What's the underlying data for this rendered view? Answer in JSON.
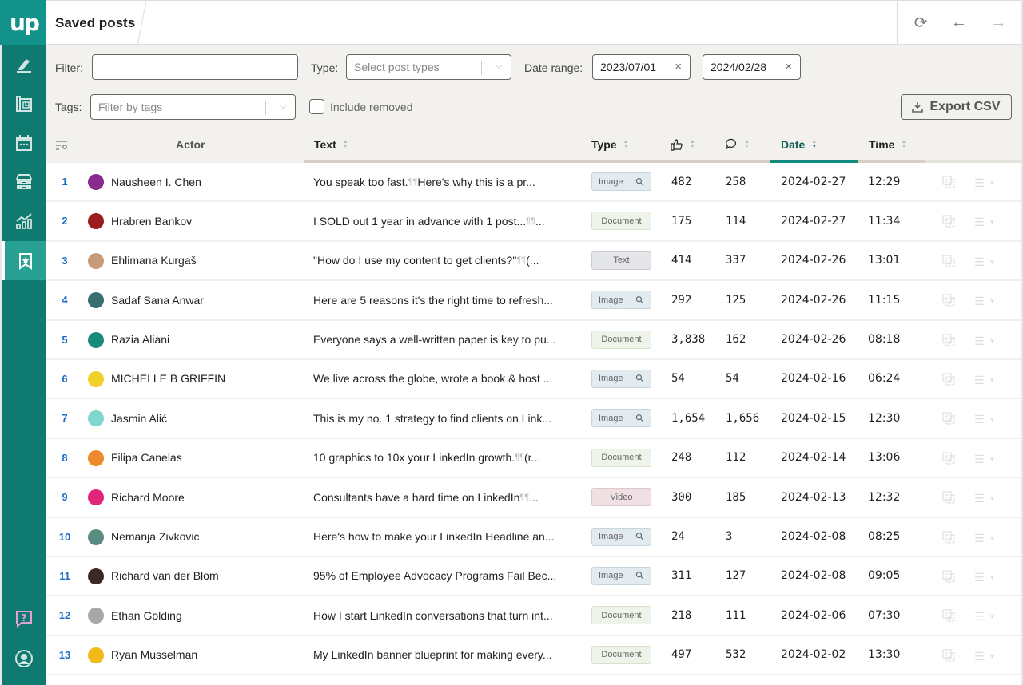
{
  "app": {
    "logo": "up",
    "title": "Saved posts"
  },
  "sidebar": {
    "items": [
      {
        "name": "compose",
        "icon": "pencil-icon"
      },
      {
        "name": "blueprint",
        "icon": "blueprint-icon"
      },
      {
        "name": "calendar",
        "icon": "calendar-icon"
      },
      {
        "name": "archive",
        "icon": "drawer-icon"
      },
      {
        "name": "analytics",
        "icon": "chart-icon"
      },
      {
        "name": "saved-posts",
        "icon": "bookmark-star-icon",
        "active": true
      }
    ],
    "bottom": [
      {
        "name": "help",
        "icon": "help-icon"
      },
      {
        "name": "profile",
        "icon": "user-icon"
      }
    ]
  },
  "topbar": {
    "refresh": "⟳",
    "back": "←",
    "forward": "→"
  },
  "filters": {
    "filter_label": "Filter:",
    "filter_value": "",
    "type_label": "Type:",
    "type_placeholder": "Select post types",
    "date_label": "Date range:",
    "date_from": "2023/07/01",
    "date_to": "2024/02/28",
    "date_sep": "–",
    "tags_label": "Tags:",
    "tags_placeholder": "Filter by tags",
    "include_removed_label": "Include removed",
    "include_removed": false,
    "export_label": "Export CSV"
  },
  "table": {
    "columns": {
      "actor": "Actor",
      "text": "Text",
      "type": "Type",
      "date": "Date",
      "time": "Time"
    },
    "sorted_by": "Date",
    "sort_dir": "desc",
    "rows": [
      {
        "n": "1",
        "actor": "Nausheen I. Chen",
        "text": "You speak too fast. ¶ ¶ Here's why this is a pr...",
        "type": "Image",
        "likes": "482",
        "comments": "258",
        "date": "2024-02-27",
        "time": "12:29",
        "avatar": "#8a2a8f"
      },
      {
        "n": "2",
        "actor": "Hrabren Bankov",
        "text": "I SOLD out 1 year in advance with 1 post... ¶ ¶ ...",
        "type": "Document",
        "likes": "175",
        "comments": "114",
        "date": "2024-02-27",
        "time": "11:34",
        "avatar": "#9a1c1c"
      },
      {
        "n": "3",
        "actor": "Ehlimana Kurgaš",
        "text": "\"How do I use my content to get clients?\" ¶ ¶ (...",
        "type": "Text",
        "likes": "414",
        "comments": "337",
        "date": "2024-02-26",
        "time": "13:01",
        "avatar": "#c79a7a"
      },
      {
        "n": "4",
        "actor": "Sadaf Sana Anwar",
        "text": "Here are 5 reasons it's the right time to refresh...",
        "type": "Image",
        "likes": "292",
        "comments": "125",
        "date": "2024-02-26",
        "time": "11:15",
        "avatar": "#3a6f70"
      },
      {
        "n": "5",
        "actor": "Razia Aliani",
        "text": "Everyone says a well-written paper is key to pu...",
        "type": "Document",
        "likes": "3,838",
        "comments": "162",
        "date": "2024-02-26",
        "time": "08:18",
        "avatar": "#1a8a7a"
      },
      {
        "n": "6",
        "actor": "MICHELLE B GRIFFIN",
        "text": "We live across the globe, wrote a book & host ...",
        "type": "Image",
        "likes": "54",
        "comments": "54",
        "date": "2024-02-16",
        "time": "06:24",
        "avatar": "#f2d22a"
      },
      {
        "n": "7",
        "actor": "Jasmin Alić",
        "text": "This is my no. 1 strategy to find clients on Link...",
        "type": "Image",
        "likes": "1,654",
        "comments": "1,656",
        "date": "2024-02-15",
        "time": "12:30",
        "avatar": "#7fd6cf"
      },
      {
        "n": "8",
        "actor": "Filipa Canelas",
        "text": "10 graphics to 10x your LinkedIn growth. ¶ ¶ (r...",
        "type": "Document",
        "likes": "248",
        "comments": "112",
        "date": "2024-02-14",
        "time": "13:06",
        "avatar": "#ef8a2a"
      },
      {
        "n": "9",
        "actor": "Richard Moore",
        "text": "Consultants have a hard time on LinkedIn ¶ ¶ ...",
        "type": "Video",
        "likes": "300",
        "comments": "185",
        "date": "2024-02-13",
        "time": "12:32",
        "avatar": "#e0247a"
      },
      {
        "n": "10",
        "actor": "Nemanja Zivkovic",
        "text": "Here's how to make your LinkedIn Headline an...",
        "type": "Image",
        "likes": "24",
        "comments": "3",
        "date": "2024-02-08",
        "time": "08:25",
        "avatar": "#5a8a80"
      },
      {
        "n": "11",
        "actor": "Richard van der Blom",
        "text": "95% of Employee Advocacy Programs Fail Bec...",
        "type": "Image",
        "likes": "311",
        "comments": "127",
        "date": "2024-02-08",
        "time": "09:05",
        "avatar": "#3a2a22"
      },
      {
        "n": "12",
        "actor": "Ethan Golding",
        "text": "How I start LinkedIn conversations that turn int...",
        "type": "Document",
        "likes": "218",
        "comments": "111",
        "date": "2024-02-06",
        "time": "07:30",
        "avatar": "#a8a8a8"
      },
      {
        "n": "13",
        "actor": "Ryan Musselman",
        "text": "My LinkedIn banner blueprint for making every...",
        "type": "Document",
        "likes": "497",
        "comments": "532",
        "date": "2024-02-02",
        "time": "13:30",
        "avatar": "#f2b81a"
      }
    ]
  },
  "colors": {
    "brand": "#0f7b70",
    "brand_light": "#12928a",
    "active_nav": "#28a094",
    "link": "#1a6cc7"
  }
}
